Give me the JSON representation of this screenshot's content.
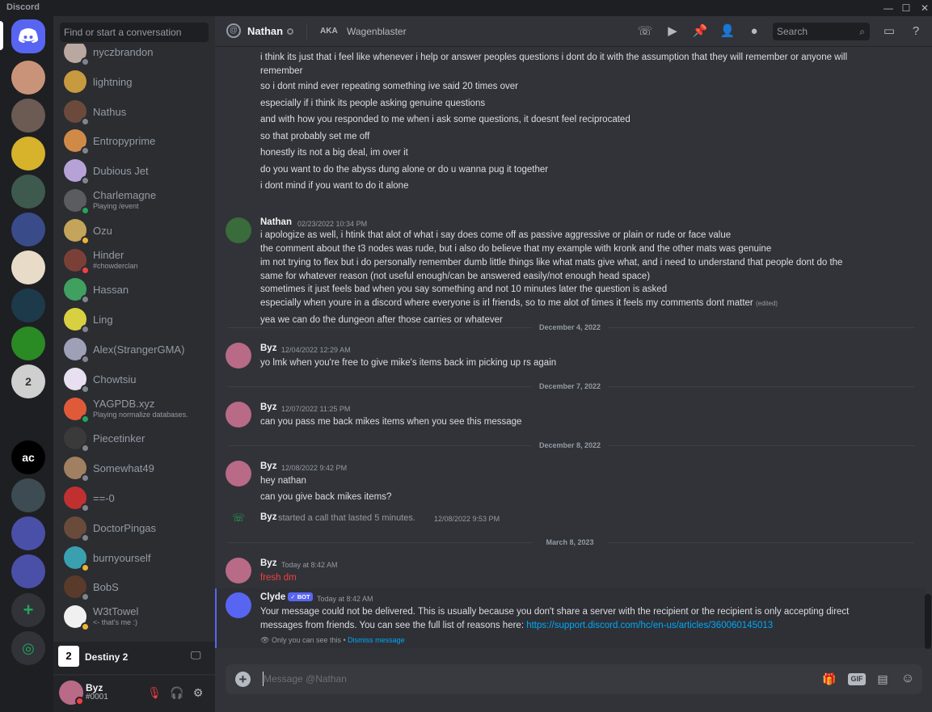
{
  "app": {
    "title": "Discord"
  },
  "window": {
    "minimize": "—",
    "maximize": "☐",
    "close": "✕"
  },
  "guilds": [
    {
      "name": "home",
      "label": "",
      "color": "#5865f2"
    },
    {
      "name": "server-1",
      "label": "",
      "color": "#c9937a"
    },
    {
      "name": "server-2",
      "label": "",
      "color": "#6b5b52"
    },
    {
      "name": "server-3",
      "label": "",
      "color": "#d6b32a"
    },
    {
      "name": "server-4",
      "label": "",
      "color": "#3e5a4e"
    },
    {
      "name": "server-5",
      "label": "",
      "color": "#3a4b8a"
    },
    {
      "name": "server-6",
      "label": "",
      "color": "#e8dcc8"
    },
    {
      "name": "server-7",
      "label": "",
      "color": "#1d3a4a"
    },
    {
      "name": "server-8",
      "label": "",
      "color": "#2a8a24"
    },
    {
      "name": "server-destiny",
      "label": "2",
      "color": "#cfcfcf"
    },
    {
      "name": "server-helmet",
      "label": "",
      "color": "#1e1f22"
    },
    {
      "name": "server-ac",
      "label": "ac",
      "color": "#000000"
    },
    {
      "name": "server-10",
      "label": "",
      "color": "#3d4b52"
    },
    {
      "name": "folder-1",
      "label": "",
      "color": "#4a4fa8"
    },
    {
      "name": "folder-2",
      "label": "",
      "color": "#4a4fa8"
    }
  ],
  "add_server": "+",
  "explore": "◎",
  "dm_search": {
    "placeholder": "Find or start a conversation"
  },
  "dms": [
    {
      "name": "nyczbrandon",
      "sub": "",
      "status": "off",
      "color": "#b9a8a0"
    },
    {
      "name": "lightning",
      "sub": "",
      "status": "",
      "color": "#c89a40"
    },
    {
      "name": "Nathus",
      "sub": "",
      "status": "off",
      "color": "#6b4a3c"
    },
    {
      "name": "Entropyprime",
      "sub": "",
      "status": "off",
      "color": "#d08a48"
    },
    {
      "name": "Dubious Jet",
      "sub": "",
      "status": "off",
      "color": "#b7a2d8"
    },
    {
      "name": "Charlemagne",
      "sub": "Playing /event",
      "status": "on",
      "color": "#5a5c60"
    },
    {
      "name": "Ozu",
      "sub": "",
      "status": "idle",
      "color": "#c4a45a"
    },
    {
      "name": "Hinder",
      "sub": "#chowderclan",
      "status": "dnd",
      "color": "#7a4038"
    },
    {
      "name": "Hassan",
      "sub": "",
      "status": "off",
      "color": "#3fa060"
    },
    {
      "name": "Ling",
      "sub": "",
      "status": "off",
      "color": "#d8d040"
    },
    {
      "name": "Alex(StrangerGMA)",
      "sub": "",
      "status": "off",
      "color": "#9ea0b8"
    },
    {
      "name": "Chowtsiu",
      "sub": "",
      "status": "off",
      "color": "#e8e0f0"
    },
    {
      "name": "YAGPDB.xyz",
      "sub": "Playing normalize databases.",
      "status": "on",
      "color": "#e05a3a"
    },
    {
      "name": "Piecetinker",
      "sub": "",
      "status": "off",
      "color": "#3a3a3a"
    },
    {
      "name": "Somewhat49",
      "sub": "",
      "status": "off",
      "color": "#a08060"
    },
    {
      "name": "==-0",
      "sub": "",
      "status": "off",
      "color": "#c03030"
    },
    {
      "name": "DoctorPingas",
      "sub": "",
      "status": "off",
      "color": "#6a4a3a"
    },
    {
      "name": "burnyourself",
      "sub": "",
      "status": "idle",
      "color": "#3aa0b0"
    },
    {
      "name": "BobS",
      "sub": "",
      "status": "off",
      "color": "#5a3a2a"
    },
    {
      "name": "W3tTowel",
      "sub": "<- that's me :)",
      "status": "idle",
      "color": "#f0f0f0"
    }
  ],
  "activity": {
    "game": "Destiny 2",
    "icon": "2"
  },
  "user": {
    "name": "Byz",
    "tag": "#0001",
    "mute": "🎙",
    "deafen": "🎧",
    "settings": "⚙"
  },
  "header": {
    "name": "Nathan",
    "aka": "AKA",
    "alias": "Wagenblaster",
    "search_placeholder": "Search",
    "at_icon": "@"
  },
  "messages": {
    "n1": [
      "i think its just that i feel like whenever i help or answer peoples questions i dont do it with the assumption that they will remember or anyone will",
      "remember",
      "so i dont mind ever repeating something ive said 20 times over",
      "especially if i think its people asking genuine questions",
      "and with how you responded to me when i ask some questions, it doesnt feel reciprocated",
      "so that probably set me off",
      "honestly its not a big deal, im over it",
      "do you want to do the abyss dung alone or do u wanna pug it together",
      "i dont mind if you want to do it alone"
    ],
    "nathan": {
      "name": "Nathan",
      "time": "02/23/2022 10:34 PM",
      "lines": [
        "i apologize as well, i htink that alot of what i say does come off as passive aggressive or plain or rude or face value",
        "the comment about the t3 nodes was rude, but i also do believe that my example with kronk and the other mats was genuine",
        "im not trying to flex but i do personally remember dumb little things like what mats give what, and i need to understand that people dont do the",
        "same for whatever reason (not useful enough/can be answered easily/not enough head space)",
        "sometimes it just feels bad when you say something and not 10 minutes later the question is asked",
        "especially when youre in a discord where everyone is irl friends, so to me alot of times it feels my comments dont matter",
        "yea we can do the dungeon after those carries or whatever"
      ],
      "edited": "(edited)"
    },
    "div1": "December 4, 2022",
    "m2": {
      "name": "Byz",
      "time": "12/04/2022 12:29 AM",
      "text": "yo lmk when you're free to give mike's items back im picking up rs again"
    },
    "div2": "December 7, 2022",
    "m3": {
      "name": "Byz",
      "time": "12/07/2022 11:25 PM",
      "text": "can you pass me back mikes items when you see this message"
    },
    "div3": "December 8, 2022",
    "m4": {
      "name": "Byz",
      "time": "12/08/2022 9:42 PM",
      "line1": "hey nathan",
      "line2": "can you give back mikes items?"
    },
    "call": {
      "name": "Byz",
      "text": "started a call that lasted 5 minutes.",
      "time": "12/08/2022 9:53 PM"
    },
    "div4": "March 8, 2023",
    "m5": {
      "name": "Byz",
      "time": "Today at 8:42 AM",
      "text": "fresh dm"
    },
    "clyde": {
      "name": "Clyde",
      "badge": "✓ BOT",
      "time": "Today at 8:42 AM",
      "line1": "Your message could not be delivered. This is usually because you don't share a server with the recipient or the recipient is only accepting direct",
      "line2": "messages from friends. You can see the full list of reasons here: ",
      "link": "https://support.discord.com/hc/en-us/articles/360060145013",
      "only": "Only you can see this",
      "dot": " • ",
      "dismiss": "Dismiss message"
    }
  },
  "composer": {
    "placeholder": "Message @Nathan",
    "gif": "GIF"
  }
}
